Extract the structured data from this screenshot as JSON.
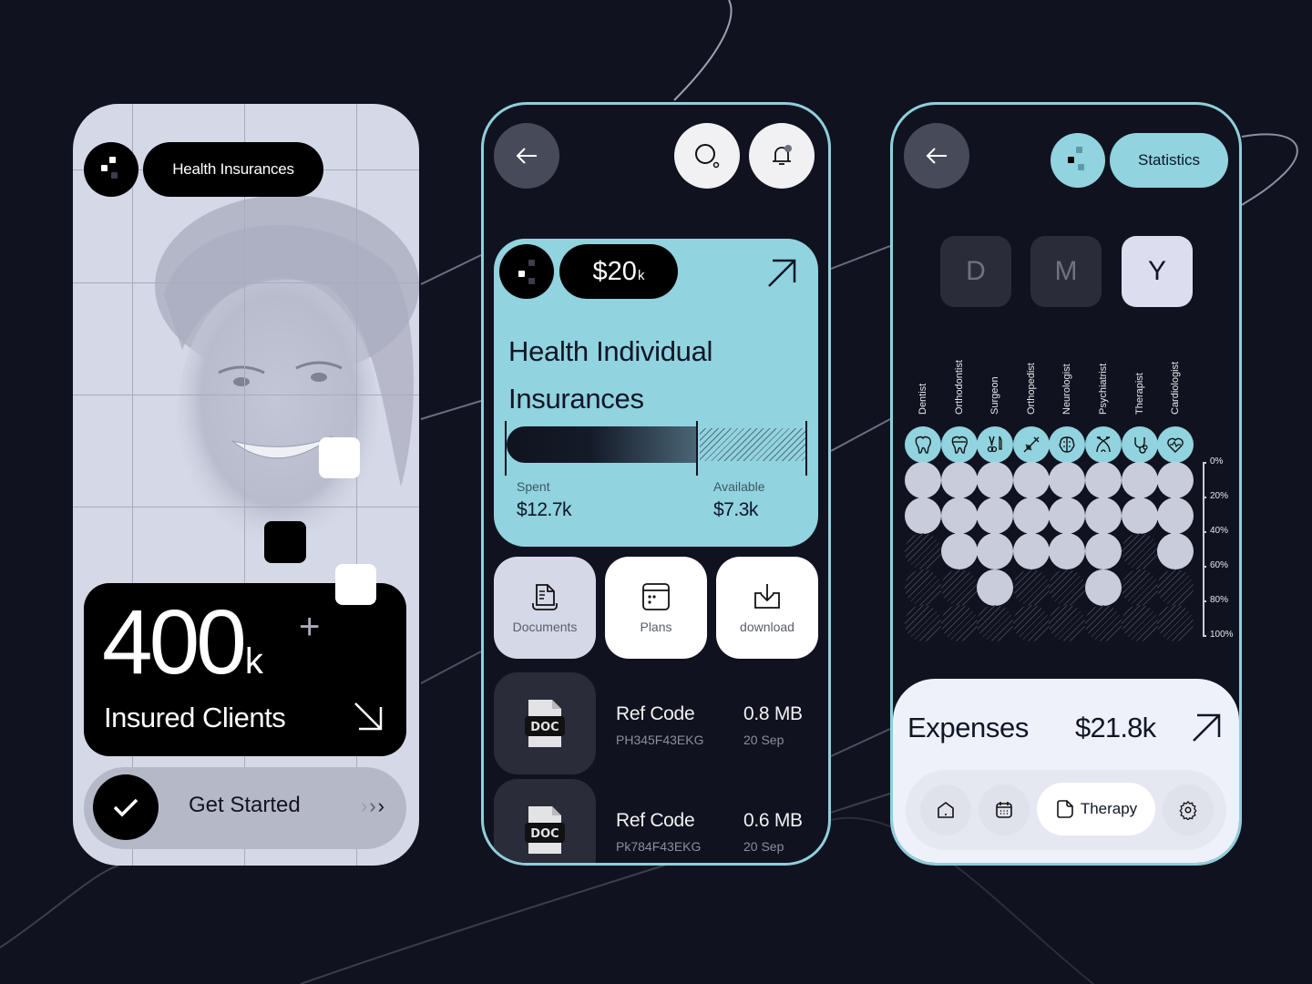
{
  "colors": {
    "background": "#10131f",
    "accent_teal": "#91d3df",
    "light_panel": "#d5d8e6",
    "black": "#000000"
  },
  "phone1": {
    "badge_label": "Health Insurances",
    "logo_icon": "pixel-dots-logo",
    "stat_number": "400",
    "stat_unit": "k",
    "stat_suffix": "+",
    "stat_label": "Insured Clients",
    "stat_arrow_icon": "arrow-down-right-icon",
    "cta_label": "Get Started",
    "cta_icon": "check-icon",
    "cta_chevrons": "›››"
  },
  "phone2": {
    "back_icon": "arrow-left-icon",
    "search_icon": "search-icon",
    "notification_icon": "bell-icon",
    "card": {
      "amount": "$20",
      "amount_unit": "k",
      "title_line1": "Health Individual",
      "title_line2": "Insurances",
      "spent_label": "Spent",
      "spent_value": "$12.7k",
      "available_label": "Available",
      "available_value": "$7.3k",
      "spent_fraction": 0.635
    },
    "tiles": [
      {
        "label": "Documents",
        "icon": "document-icon",
        "active": true
      },
      {
        "label": "Plans",
        "icon": "calendar-plan-icon",
        "active": false
      },
      {
        "label": "download",
        "icon": "download-icon",
        "active": false
      }
    ],
    "documents": [
      {
        "type_label": "DOC",
        "title": "Ref Code",
        "code": "PH345F43EKG",
        "size": "0.8 MB",
        "date": "20 Sep"
      },
      {
        "type_label": "DOC",
        "title": "Ref Code",
        "code": "Pk784F43EKG",
        "size": "0.6 MB",
        "date": "20 Sep"
      }
    ]
  },
  "phone3": {
    "back_icon": "arrow-left-icon",
    "header_pill": "Statistics",
    "periods": [
      {
        "label": "D",
        "active": false
      },
      {
        "label": "M",
        "active": false
      },
      {
        "label": "Y",
        "active": true
      }
    ],
    "expenses_label": "Expenses",
    "expenses_value": "$21.8k",
    "nav": {
      "home_icon": "home-icon",
      "calendar_icon": "calendar-icon",
      "active_label": "Therapy",
      "active_icon": "note-icon",
      "settings_icon": "gear-icon"
    }
  },
  "chart_data": {
    "type": "heatmap",
    "title": "Statistics",
    "categories": [
      "Dentist",
      "Orthodontist",
      "Surgeon",
      "Orthopedist",
      "Neurologist",
      "Psychiatrist",
      "Therapist",
      "Cardiologist"
    ],
    "category_icons": [
      "tooth-icon",
      "braces-tooth-icon",
      "surgical-tools-icon",
      "bone-syringe-icon",
      "brain-icon",
      "psychiatry-icon",
      "stethoscope-icon",
      "heart-pulse-icon"
    ],
    "values": [
      40,
      60,
      80,
      60,
      60,
      80,
      40,
      60
    ],
    "unit": "%",
    "y_ticks": [
      "0%",
      "20%",
      "40%",
      "60%",
      "80%",
      "100%"
    ],
    "ylim": [
      0,
      100
    ],
    "step": 20,
    "grid": false
  }
}
